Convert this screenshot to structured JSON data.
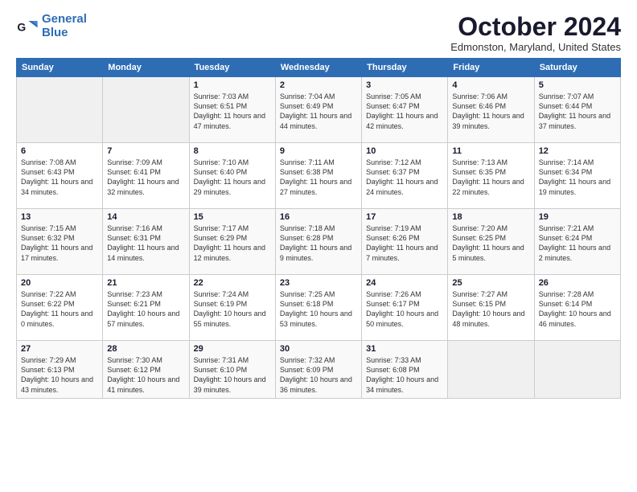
{
  "logo": {
    "line1": "General",
    "line2": "Blue"
  },
  "title": "October 2024",
  "location": "Edmonston, Maryland, United States",
  "days_of_week": [
    "Sunday",
    "Monday",
    "Tuesday",
    "Wednesday",
    "Thursday",
    "Friday",
    "Saturday"
  ],
  "weeks": [
    [
      {
        "day": "",
        "info": ""
      },
      {
        "day": "",
        "info": ""
      },
      {
        "day": "1",
        "info": "Sunrise: 7:03 AM\nSunset: 6:51 PM\nDaylight: 11 hours and 47 minutes."
      },
      {
        "day": "2",
        "info": "Sunrise: 7:04 AM\nSunset: 6:49 PM\nDaylight: 11 hours and 44 minutes."
      },
      {
        "day": "3",
        "info": "Sunrise: 7:05 AM\nSunset: 6:47 PM\nDaylight: 11 hours and 42 minutes."
      },
      {
        "day": "4",
        "info": "Sunrise: 7:06 AM\nSunset: 6:46 PM\nDaylight: 11 hours and 39 minutes."
      },
      {
        "day": "5",
        "info": "Sunrise: 7:07 AM\nSunset: 6:44 PM\nDaylight: 11 hours and 37 minutes."
      }
    ],
    [
      {
        "day": "6",
        "info": "Sunrise: 7:08 AM\nSunset: 6:43 PM\nDaylight: 11 hours and 34 minutes."
      },
      {
        "day": "7",
        "info": "Sunrise: 7:09 AM\nSunset: 6:41 PM\nDaylight: 11 hours and 32 minutes."
      },
      {
        "day": "8",
        "info": "Sunrise: 7:10 AM\nSunset: 6:40 PM\nDaylight: 11 hours and 29 minutes."
      },
      {
        "day": "9",
        "info": "Sunrise: 7:11 AM\nSunset: 6:38 PM\nDaylight: 11 hours and 27 minutes."
      },
      {
        "day": "10",
        "info": "Sunrise: 7:12 AM\nSunset: 6:37 PM\nDaylight: 11 hours and 24 minutes."
      },
      {
        "day": "11",
        "info": "Sunrise: 7:13 AM\nSunset: 6:35 PM\nDaylight: 11 hours and 22 minutes."
      },
      {
        "day": "12",
        "info": "Sunrise: 7:14 AM\nSunset: 6:34 PM\nDaylight: 11 hours and 19 minutes."
      }
    ],
    [
      {
        "day": "13",
        "info": "Sunrise: 7:15 AM\nSunset: 6:32 PM\nDaylight: 11 hours and 17 minutes."
      },
      {
        "day": "14",
        "info": "Sunrise: 7:16 AM\nSunset: 6:31 PM\nDaylight: 11 hours and 14 minutes."
      },
      {
        "day": "15",
        "info": "Sunrise: 7:17 AM\nSunset: 6:29 PM\nDaylight: 11 hours and 12 minutes."
      },
      {
        "day": "16",
        "info": "Sunrise: 7:18 AM\nSunset: 6:28 PM\nDaylight: 11 hours and 9 minutes."
      },
      {
        "day": "17",
        "info": "Sunrise: 7:19 AM\nSunset: 6:26 PM\nDaylight: 11 hours and 7 minutes."
      },
      {
        "day": "18",
        "info": "Sunrise: 7:20 AM\nSunset: 6:25 PM\nDaylight: 11 hours and 5 minutes."
      },
      {
        "day": "19",
        "info": "Sunrise: 7:21 AM\nSunset: 6:24 PM\nDaylight: 11 hours and 2 minutes."
      }
    ],
    [
      {
        "day": "20",
        "info": "Sunrise: 7:22 AM\nSunset: 6:22 PM\nDaylight: 11 hours and 0 minutes."
      },
      {
        "day": "21",
        "info": "Sunrise: 7:23 AM\nSunset: 6:21 PM\nDaylight: 10 hours and 57 minutes."
      },
      {
        "day": "22",
        "info": "Sunrise: 7:24 AM\nSunset: 6:19 PM\nDaylight: 10 hours and 55 minutes."
      },
      {
        "day": "23",
        "info": "Sunrise: 7:25 AM\nSunset: 6:18 PM\nDaylight: 10 hours and 53 minutes."
      },
      {
        "day": "24",
        "info": "Sunrise: 7:26 AM\nSunset: 6:17 PM\nDaylight: 10 hours and 50 minutes."
      },
      {
        "day": "25",
        "info": "Sunrise: 7:27 AM\nSunset: 6:15 PM\nDaylight: 10 hours and 48 minutes."
      },
      {
        "day": "26",
        "info": "Sunrise: 7:28 AM\nSunset: 6:14 PM\nDaylight: 10 hours and 46 minutes."
      }
    ],
    [
      {
        "day": "27",
        "info": "Sunrise: 7:29 AM\nSunset: 6:13 PM\nDaylight: 10 hours and 43 minutes."
      },
      {
        "day": "28",
        "info": "Sunrise: 7:30 AM\nSunset: 6:12 PM\nDaylight: 10 hours and 41 minutes."
      },
      {
        "day": "29",
        "info": "Sunrise: 7:31 AM\nSunset: 6:10 PM\nDaylight: 10 hours and 39 minutes."
      },
      {
        "day": "30",
        "info": "Sunrise: 7:32 AM\nSunset: 6:09 PM\nDaylight: 10 hours and 36 minutes."
      },
      {
        "day": "31",
        "info": "Sunrise: 7:33 AM\nSunset: 6:08 PM\nDaylight: 10 hours and 34 minutes."
      },
      {
        "day": "",
        "info": ""
      },
      {
        "day": "",
        "info": ""
      }
    ]
  ]
}
